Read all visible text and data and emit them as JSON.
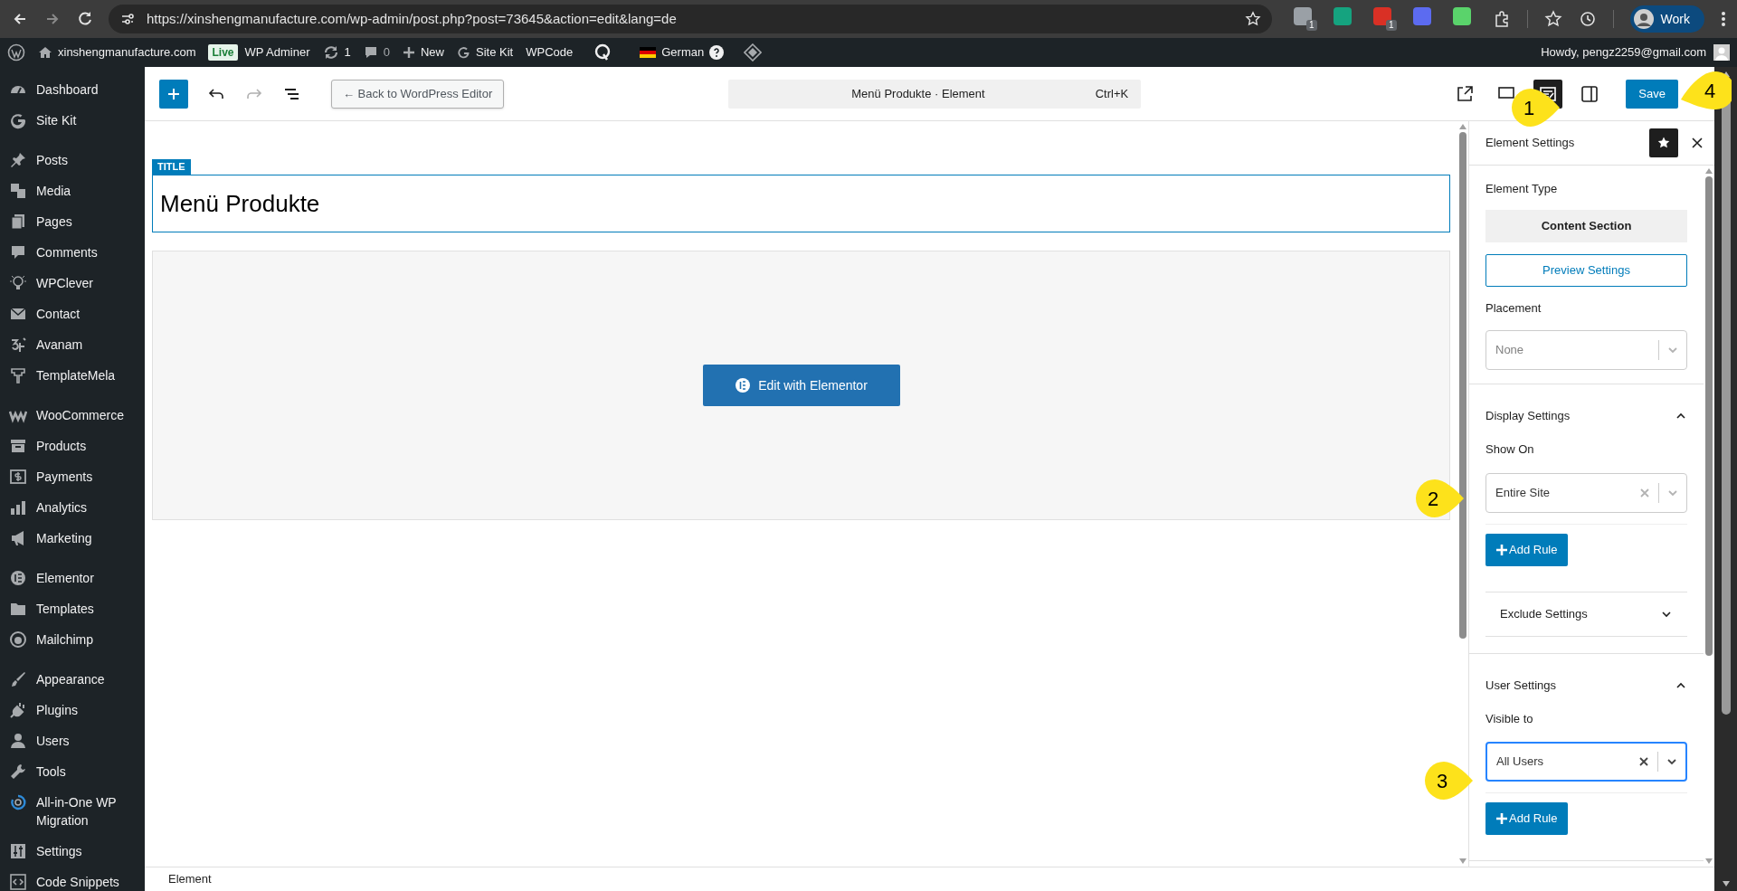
{
  "browser": {
    "url": "https://xinshengmanufacture.com/wp-admin/post.php?post=73645&action=edit&lang=de",
    "extension_badges": [
      "1",
      "1"
    ],
    "profile": "Work"
  },
  "admin_bar": {
    "site": "xinshengmanufacture.com",
    "live_badge": "Live",
    "items": [
      {
        "kind": "text",
        "label": "WP Adminer"
      },
      {
        "kind": "updates",
        "label": "1"
      },
      {
        "kind": "comments",
        "label": "0"
      },
      {
        "kind": "new",
        "label": "New"
      },
      {
        "kind": "sitekit",
        "label": "Site Kit"
      },
      {
        "kind": "text",
        "label": "WPCode"
      },
      {
        "kind": "qicon"
      },
      {
        "kind": "language",
        "label": "German"
      },
      {
        "kind": "diamond"
      }
    ],
    "greeting": "Howdy, pengz2259@gmail.com"
  },
  "sidebar": {
    "groups": [
      [
        {
          "label": "Dashboard"
        },
        {
          "label": "Site Kit"
        }
      ],
      [
        {
          "label": "Posts"
        },
        {
          "label": "Media"
        },
        {
          "label": "Pages"
        },
        {
          "label": "Comments"
        },
        {
          "label": "WPClever"
        },
        {
          "label": "Contact"
        },
        {
          "label": "Avanam"
        },
        {
          "label": "TemplateMela"
        }
      ],
      [
        {
          "label": "WooCommerce"
        },
        {
          "label": "Products"
        },
        {
          "label": "Payments"
        },
        {
          "label": "Analytics"
        },
        {
          "label": "Marketing"
        }
      ],
      [
        {
          "label": "Elementor"
        },
        {
          "label": "Templates"
        },
        {
          "label": "Mailchimp"
        }
      ],
      [
        {
          "label": "Appearance"
        },
        {
          "label": "Plugins"
        },
        {
          "label": "Users"
        },
        {
          "label": "Tools"
        },
        {
          "label": "All-in-One WP Migration"
        },
        {
          "label": "Settings"
        },
        {
          "label": "Code Snippets"
        }
      ]
    ]
  },
  "editor_toolbar": {
    "back_button": "← Back to WordPress Editor",
    "command_title": "Menü Produkte · Element",
    "shortcut": "Ctrl+K",
    "tool_buttons": [
      {
        "kind": "external",
        "selected": false
      },
      {
        "kind": "preview",
        "selected": false
      },
      {
        "kind": "settings",
        "selected": true
      },
      {
        "kind": "sidebar",
        "selected": false
      }
    ],
    "save_button": "Save"
  },
  "canvas": {
    "title_badge": "TITLE",
    "title": "Menü Produkte",
    "edit_button": "Edit with Elementor"
  },
  "panel": {
    "title": "Element Settings",
    "element_type_label": "Element Type",
    "element_type": "Content Section",
    "preview_button": "Preview Settings",
    "placement_label": "Placement",
    "placement": {
      "placeholder": "None",
      "clearable": false,
      "focused": false
    },
    "sections": [
      {
        "title": "Display Settings",
        "expanded": true,
        "field_label": "Show On",
        "select": {
          "value": "Entire Site",
          "clearable": true,
          "focused": false
        },
        "add_rule": "Add Rule",
        "subsection": {
          "title": "Exclude Settings",
          "expanded": false
        }
      },
      {
        "title": "User Settings",
        "expanded": true,
        "field_label": "Visible to",
        "select": {
          "value": "All Users",
          "clearable": true,
          "focused": true
        },
        "add_rule": "Add Rule"
      }
    ]
  },
  "status_bar": "Element",
  "callouts": [
    "1",
    "2",
    "3",
    "4"
  ]
}
